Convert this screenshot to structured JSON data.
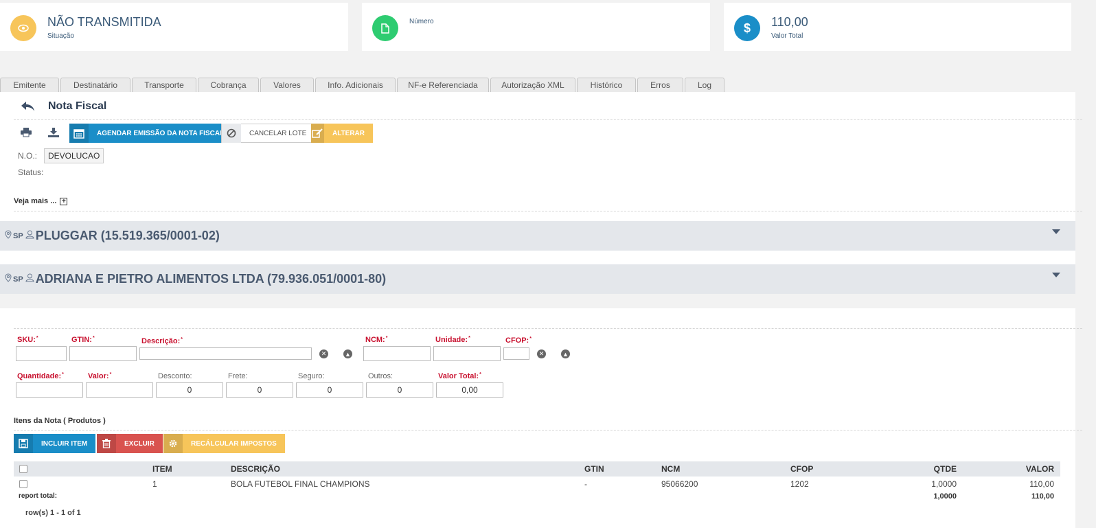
{
  "cards": {
    "situacao": {
      "value": "NÃO TRANSMITIDA",
      "label": "Situação",
      "color": "#f7c55a"
    },
    "numero": {
      "label": "Número",
      "color": "#2ecc71"
    },
    "total": {
      "value": "110,00",
      "label": "Valor Total",
      "color": "#1a8ec8"
    }
  },
  "tabs": [
    "Emitente",
    "Destinatário",
    "Transporte",
    "Cobrança",
    "Valores",
    "Info. Adicionais",
    "NF-e Referenciada",
    "Autorização XML",
    "Histórico",
    "Erros",
    "Log"
  ],
  "header": {
    "title": "Nota Fiscal",
    "agendar": "AGENDAR EMISSÃO DA NOTA FISCAL",
    "cancelar": "CANCELAR LOTE",
    "alterar": "ALTERAR",
    "no_label": "N.O.:",
    "no_value": "DEVOLUCAO",
    "status_label": "Status:",
    "veja_mais": "Veja mais ..."
  },
  "emitente": {
    "uf": "SP",
    "name": "PLUGGAR (15.519.365/0001-02)"
  },
  "destinatario": {
    "uf": "SP",
    "name": "ADRIANA E PIETRO ALIMENTOS LTDA (79.936.051/0001-80)"
  },
  "form": {
    "sku": "SKU:",
    "gtin": "GTIN:",
    "descricao": "Descrição:",
    "ncm": "NCM:",
    "unidade": "Unidade:",
    "cfop": "CFOP:",
    "quantidade": "Quantidade:",
    "valor": "Valor:",
    "desconto": "Desconto:",
    "frete": "Frete:",
    "seguro": "Seguro:",
    "outros": "Outros:",
    "valor_total": "Valor Total:",
    "desconto_value": "0",
    "frete_value": "0",
    "seguro_value": "0",
    "outros_value": "0",
    "valor_total_value": "0,00"
  },
  "items": {
    "title": "Itens da Nota ( Produtos )",
    "incluir": "INCLUIR ITEM",
    "excluir": "EXCLUIR",
    "recalcular": "RECÁLCULAR IMPOSTOS",
    "columns": [
      "ITEM",
      "DESCRIÇÃO",
      "GTIN",
      "NCM",
      "CFOP",
      "QTDE",
      "VALOR"
    ],
    "rows": [
      {
        "item": "1",
        "descricao": "BOLA FUTEBOL FINAL CHAMPIONS",
        "gtin": "-",
        "ncm": "95066200",
        "cfop": "1202",
        "qtde": "1,0000",
        "valor": "110,00"
      }
    ],
    "total_label": "report total:",
    "total_qtde": "1,0000",
    "total_valor": "110,00",
    "pagination": "row(s) 1 - 1 of 1"
  },
  "colors": {
    "primary": "#1a8ec8",
    "danger": "#d9534f",
    "warning": "#f7c55a",
    "required": "#c8102e"
  }
}
